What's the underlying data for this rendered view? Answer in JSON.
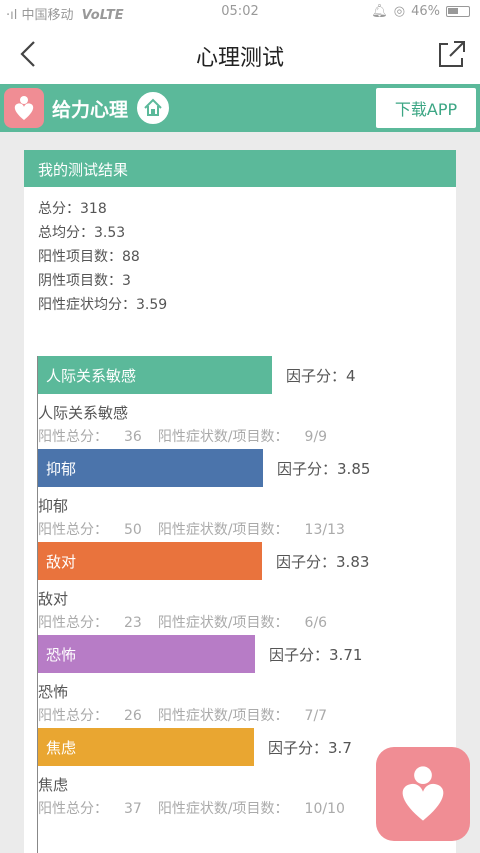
{
  "status_bar": {
    "carrier": "中国移动",
    "network": "VoLTE",
    "time": "05:02",
    "battery": "46%"
  },
  "nav": {
    "title": "心理测试"
  },
  "banner": {
    "brand": "给力心理",
    "download_label": "下载APP"
  },
  "card": {
    "title": "我的测试结果",
    "summary": [
      {
        "label": "总分：",
        "value": "318"
      },
      {
        "label": "总均分：",
        "value": "3.53"
      },
      {
        "label": "阳性项目数：",
        "value": "88"
      },
      {
        "label": "阴性项目数：",
        "value": "3"
      },
      {
        "label": "阳性症状均分：",
        "value": "3.59"
      }
    ]
  },
  "labels": {
    "factor": "因子分：",
    "positive_total": "阳性总分：",
    "ratio": "阳性症状数/项目数："
  },
  "chart_data": {
    "type": "bar",
    "orientation": "horizontal",
    "categories": [
      "人际关系敏感",
      "抑郁",
      "敌对",
      "恐怖",
      "焦虑"
    ],
    "values": [
      4,
      3.85,
      3.83,
      3.71,
      3.7
    ],
    "colors": [
      "#5bb99a",
      "#4b74ab",
      "#e9733d",
      "#b77cc6",
      "#e9a631"
    ],
    "positive_totals": [
      "36",
      "50",
      "23",
      "26",
      "37"
    ],
    "ratios": [
      "9/9",
      "13/13",
      "6/6",
      "7/7",
      "10/10"
    ]
  }
}
